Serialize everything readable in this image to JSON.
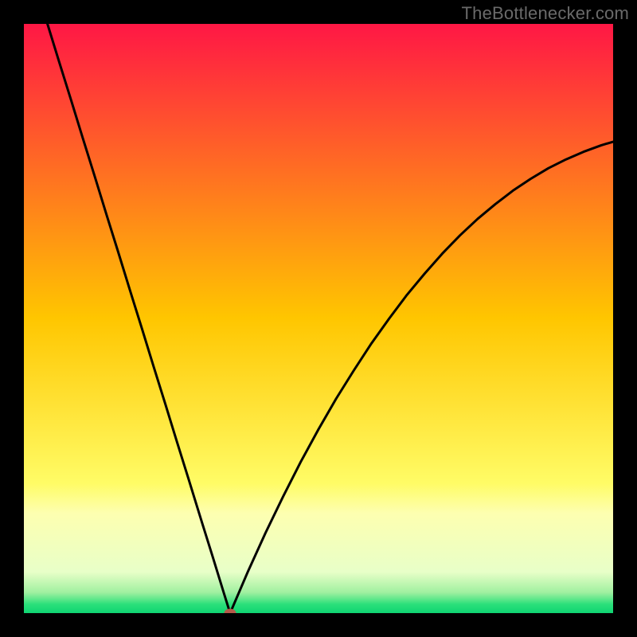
{
  "watermark": {
    "text": "TheBottlenecker.com"
  },
  "chart_data": {
    "type": "line",
    "title": "",
    "xlabel": "",
    "ylabel": "",
    "xlim": [
      0,
      100
    ],
    "ylim": [
      0,
      100
    ],
    "series": [
      {
        "name": "left-branch",
        "x": [
          4.0,
          6.0,
          8.0,
          10.0,
          12.0,
          14.0,
          16.0,
          18.0,
          20.0,
          22.0,
          24.0,
          26.0,
          28.0,
          30.0,
          32.0,
          34.0,
          35.0
        ],
        "values": [
          100.0,
          93.5,
          87.1,
          80.6,
          74.2,
          67.7,
          61.3,
          54.8,
          48.4,
          41.9,
          35.5,
          29.0,
          22.6,
          16.1,
          9.7,
          3.2,
          0.0
        ]
      },
      {
        "name": "right-branch",
        "x": [
          35.0,
          38.0,
          41.0,
          44.0,
          47.0,
          50.0,
          53.0,
          56.0,
          59.0,
          62.0,
          65.0,
          68.0,
          71.0,
          74.0,
          77.0,
          80.0,
          83.0,
          86.0,
          89.0,
          92.0,
          95.0,
          98.0,
          100.0
        ],
        "values": [
          0.0,
          7.0,
          13.6,
          19.8,
          25.7,
          31.2,
          36.4,
          41.2,
          45.8,
          50.0,
          54.0,
          57.6,
          61.0,
          64.1,
          66.9,
          69.4,
          71.7,
          73.7,
          75.5,
          77.0,
          78.3,
          79.4,
          80.0
        ]
      }
    ],
    "minimum_marker": {
      "x": 35.0,
      "y": 0.0
    },
    "background_gradient_stops": [
      {
        "offset": 0.0,
        "color": "#ff1745"
      },
      {
        "offset": 0.5,
        "color": "#ffc600"
      },
      {
        "offset": 0.78,
        "color": "#fffc66"
      },
      {
        "offset": 0.83,
        "color": "#fdffb0"
      },
      {
        "offset": 0.93,
        "color": "#e8ffc8"
      },
      {
        "offset": 0.965,
        "color": "#a0f0a0"
      },
      {
        "offset": 0.985,
        "color": "#2be07a"
      },
      {
        "offset": 1.0,
        "color": "#0fd472"
      }
    ]
  }
}
